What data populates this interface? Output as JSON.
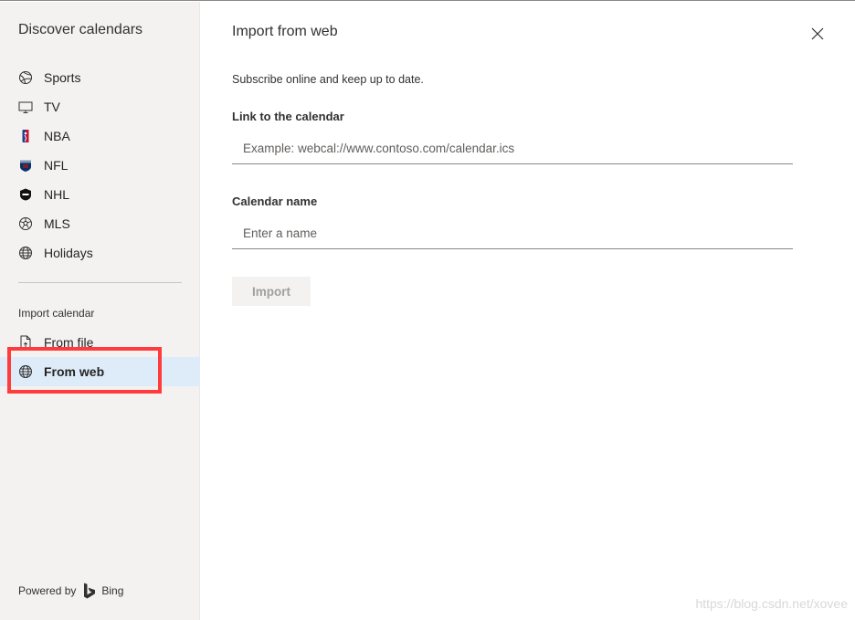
{
  "sidebar": {
    "title": "Discover calendars",
    "items": [
      {
        "label": "Sports",
        "icon": "basketball-icon"
      },
      {
        "label": "TV",
        "icon": "tv-icon"
      },
      {
        "label": "NBA",
        "icon": "nba-logo-icon"
      },
      {
        "label": "NFL",
        "icon": "nfl-logo-icon"
      },
      {
        "label": "NHL",
        "icon": "nhl-logo-icon"
      },
      {
        "label": "MLS",
        "icon": "soccer-ball-icon"
      },
      {
        "label": "Holidays",
        "icon": "globe-icon"
      }
    ],
    "import_section_label": "Import calendar",
    "import_items": [
      {
        "label": "From file",
        "icon": "file-upload-icon"
      },
      {
        "label": "From web",
        "icon": "globe-icon",
        "selected": true
      }
    ],
    "powered_by": "Powered by",
    "bing_label": "Bing"
  },
  "main": {
    "title": "Import from web",
    "subtitle": "Subscribe online and keep up to date.",
    "link_label": "Link to the calendar",
    "link_placeholder": "Example: webcal://www.contoso.com/calendar.ics",
    "link_value": "",
    "name_label": "Calendar name",
    "name_placeholder": "Enter a name",
    "name_value": "",
    "import_button": "Import"
  },
  "watermark": "https://blog.csdn.net/xovee",
  "colors": {
    "sidebar_bg": "#f3f2f1",
    "selected_bg": "#deecf9",
    "highlight_border": "#ff3b3b",
    "disabled_text": "#a19f9d"
  }
}
